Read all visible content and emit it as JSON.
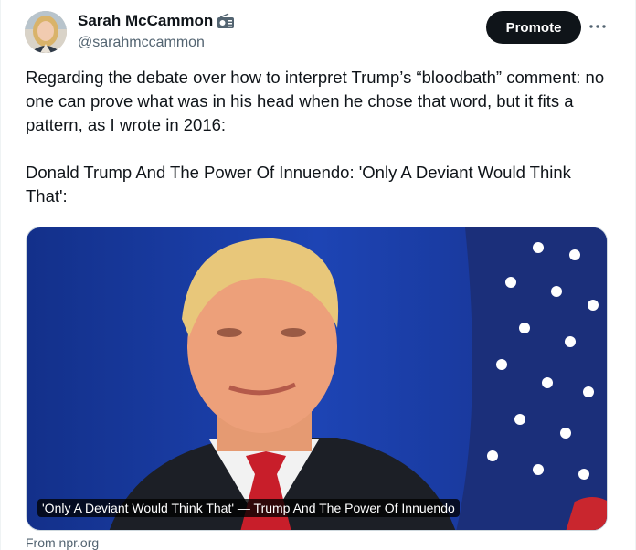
{
  "author": {
    "display_name": "Sarah McCammon",
    "handle": "@sarahmccammon",
    "badge_icon": "radio-icon",
    "avatar_icon": "avatar-photo"
  },
  "actions": {
    "promote_label": "Promote",
    "more_icon": "more-icon"
  },
  "tweet": {
    "text": "Regarding the debate over how to interpret Trump’s “bloodbath” comment: no one can prove what was in his head when he chose that word, but it fits a pattern, as I wrote in 2016:\n\nDonald Trump And The Power Of Innuendo: 'Only A Deviant Would Think That':"
  },
  "card": {
    "title": "'Only A Deviant Would Think That' — Trump And The Power Of Innuendo",
    "source": "From npr.org"
  },
  "colors": {
    "text": "#0f1419",
    "secondary": "#536471",
    "button_bg": "#0f1419",
    "photo_background_blue": "#1d3fa8"
  }
}
